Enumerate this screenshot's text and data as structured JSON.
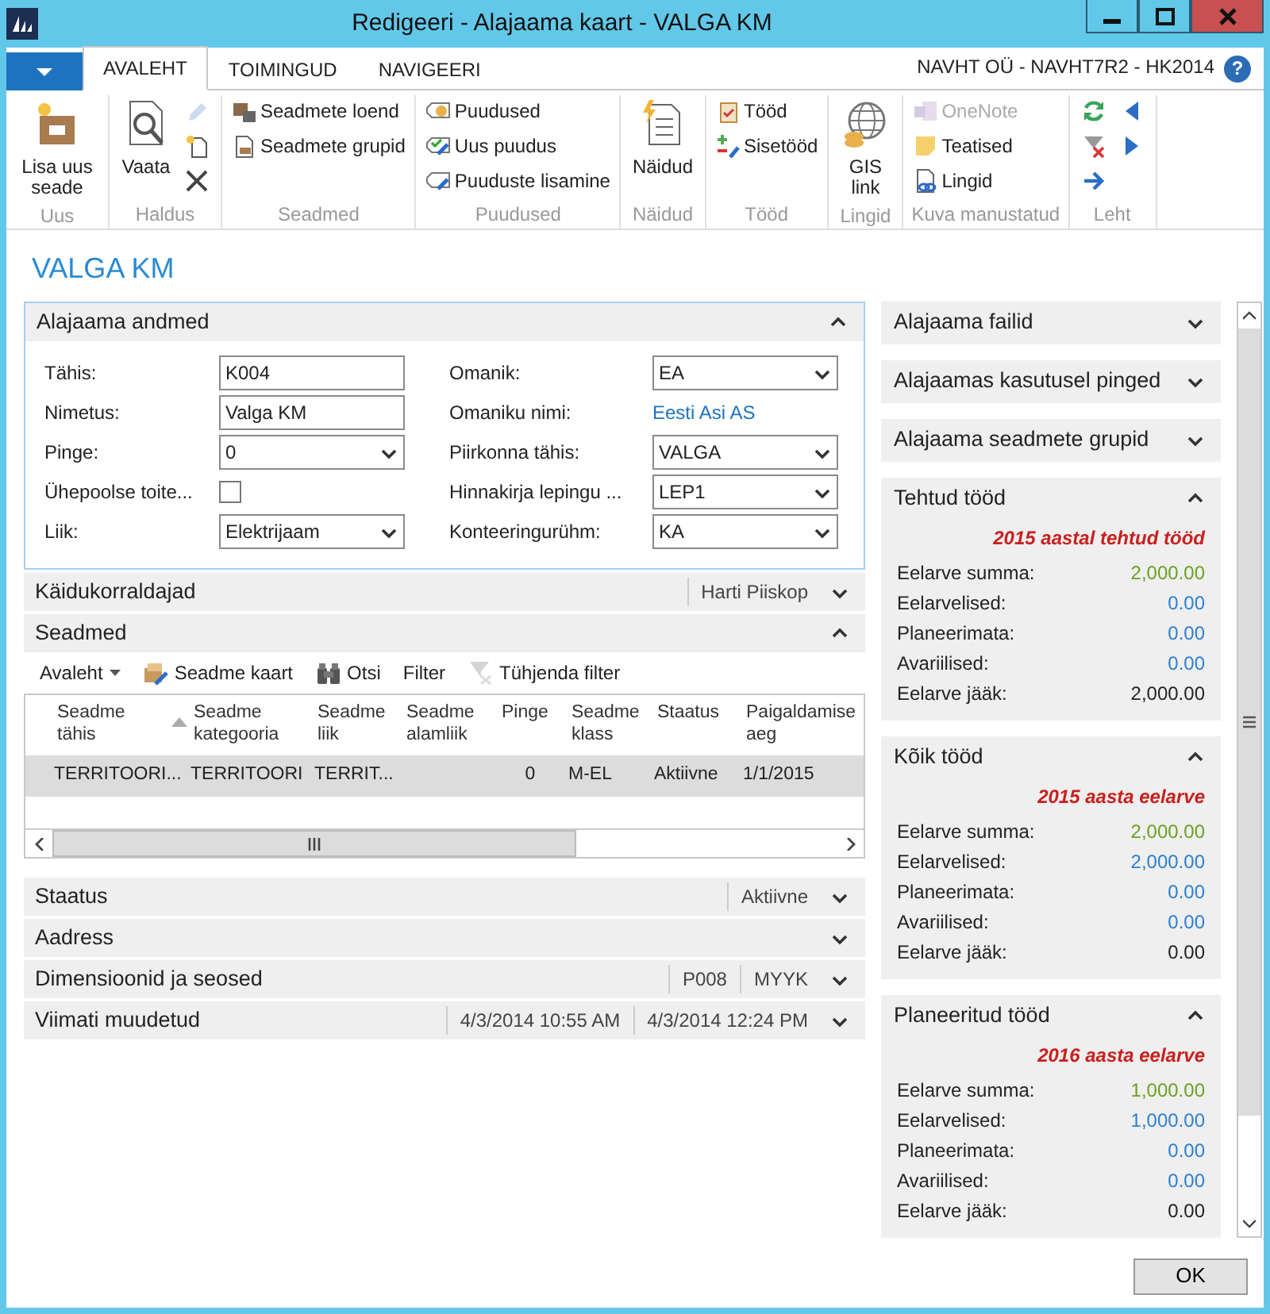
{
  "window": {
    "title": "Redigeeri - Alajaama kaart - VALGA KM"
  },
  "ribbon": {
    "tabs": [
      {
        "label": "AVALEHT",
        "selected": true
      },
      {
        "label": "TOIMINGUD",
        "selected": false
      },
      {
        "label": "NAVIGEERI",
        "selected": false
      }
    ],
    "company": "NAVHT OÜ - NAVHT7R2 - HK2014",
    "help": "?",
    "groups": [
      {
        "label": "Uus",
        "items": [
          {
            "kind": "large",
            "label": "Lisa uus seade",
            "disabled": false
          }
        ]
      },
      {
        "label": "Haldus",
        "items": [
          {
            "kind": "large",
            "label": "Vaata",
            "disabled": false
          },
          {
            "kind": "icon",
            "disabled": true
          },
          {
            "kind": "icon",
            "disabled": false
          },
          {
            "kind": "icon",
            "disabled": false
          }
        ]
      },
      {
        "label": "Seadmed",
        "items": [
          {
            "kind": "small",
            "label": "Seadmete loend",
            "disabled": false
          },
          {
            "kind": "small",
            "label": "Seadmete grupid",
            "disabled": false
          }
        ]
      },
      {
        "label": "Puudused",
        "items": [
          {
            "kind": "small",
            "label": "Puudused",
            "disabled": false
          },
          {
            "kind": "small",
            "label": "Uus puudus",
            "disabled": false
          },
          {
            "kind": "small",
            "label": "Puuduste lisamine",
            "disabled": false
          }
        ]
      },
      {
        "label": "Näidud",
        "items": [
          {
            "kind": "large",
            "label": "Näidud",
            "disabled": false
          }
        ]
      },
      {
        "label": "Tööd",
        "items": [
          {
            "kind": "small",
            "label": "Tööd",
            "disabled": false
          },
          {
            "kind": "small",
            "label": "Sisetööd",
            "disabled": false
          }
        ]
      },
      {
        "label": "Lingid",
        "items": [
          {
            "kind": "large",
            "label": "GIS link",
            "disabled": false
          }
        ]
      },
      {
        "label": "Kuva manustatud",
        "items": [
          {
            "kind": "small",
            "label": "OneNote",
            "disabled": true
          },
          {
            "kind": "small",
            "label": "Teatised",
            "disabled": false
          },
          {
            "kind": "small",
            "label": "Lingid",
            "disabled": false
          }
        ]
      },
      {
        "label": "Leht",
        "items": [
          {
            "kind": "icon",
            "disabled": false
          },
          {
            "kind": "icon",
            "disabled": false
          },
          {
            "kind": "icon",
            "disabled": false
          },
          {
            "kind": "icon",
            "disabled": false
          },
          {
            "kind": "icon",
            "disabled": false
          }
        ]
      }
    ]
  },
  "page_title": "VALGA KM",
  "general": {
    "title": "Alajaama andmed",
    "expanded": true,
    "left_fields": [
      {
        "label": "Tähis:",
        "kind": "text",
        "value": "K004"
      },
      {
        "label": "Nimetus:",
        "kind": "text",
        "value": "Valga KM"
      },
      {
        "label": "Pinge:",
        "kind": "select",
        "value": "0"
      },
      {
        "label": "Ühepoolse toite...",
        "kind": "checkbox",
        "checked": false
      },
      {
        "label": "Liik:",
        "kind": "select",
        "value": "Elektrijaam"
      }
    ],
    "right_fields": [
      {
        "label": "Omanik:",
        "kind": "select",
        "value": "EA"
      },
      {
        "label": "Omaniku nimi:",
        "kind": "link",
        "value": "Eesti Asi AS"
      },
      {
        "label": "Piirkonna tähis:",
        "kind": "select",
        "value": "VALGA"
      },
      {
        "label": "Hinnakirja lepingu ...",
        "kind": "select",
        "value": "LEP1"
      },
      {
        "label": "Konteeringurühm:",
        "kind": "select",
        "value": "KA"
      }
    ]
  },
  "fasttabs_top": [
    {
      "title": "Käidukorraldajad",
      "expanded": false,
      "summary": [
        "Harti Piiskop"
      ]
    }
  ],
  "equipment": {
    "title": "Seadmed",
    "expanded": true,
    "actions": [
      {
        "kind": "menu",
        "label": "Avaleht",
        "disabled": false
      },
      {
        "kind": "command",
        "label": "Seadme kaart",
        "disabled": false
      },
      {
        "kind": "command",
        "label": "Otsi",
        "disabled": false
      },
      {
        "kind": "command",
        "label": "Filter",
        "disabled": false
      },
      {
        "kind": "command",
        "label": "Tühjenda filter",
        "disabled": true
      }
    ],
    "columns": [
      {
        "label": "Seadme tähis",
        "sorted": true
      },
      {
        "label": "Seadme kategooria",
        "sorted": false
      },
      {
        "label": "Seadme liik",
        "sorted": false
      },
      {
        "label": "Seadme alamliik",
        "sorted": false
      },
      {
        "label": "Pinge",
        "sorted": false
      },
      {
        "label": "Seadme klass",
        "sorted": false
      },
      {
        "label": "Staatus",
        "sorted": false
      },
      {
        "label": "Paigaldamise aeg",
        "sorted": false
      }
    ],
    "rows": [
      {
        "selected": true,
        "cells": [
          "TERRITOORI...",
          "TERRITOORI",
          "TERRIT...",
          null,
          "0",
          "M-EL",
          "Aktiivne",
          "1/1/2015"
        ]
      }
    ]
  },
  "fasttabs_bottom": [
    {
      "title": "Staatus",
      "expanded": false,
      "summary": [
        "Aktiivne"
      ]
    },
    {
      "title": "Aadress",
      "expanded": false
    },
    {
      "title": "Dimensioonid ja seosed",
      "expanded": false,
      "summary": [
        "P008",
        "MYYK"
      ]
    },
    {
      "title": "Viimati muudetud",
      "expanded": false,
      "summary": [
        "4/3/2014 10:55 AM",
        "4/3/2014 12:24 PM"
      ]
    }
  ],
  "factboxes": [
    {
      "title": "Alajaama failid",
      "expanded": false
    },
    {
      "title": "Alajaamas kasutusel pinged",
      "expanded": false
    },
    {
      "title": "Alajaama seadmete grupid",
      "expanded": false
    },
    {
      "title": "Tehtud tööd",
      "expanded": true,
      "subtitle": "2015 aastal tehtud tööd",
      "rows": [
        {
          "label": "Eelarve summa:",
          "value": "2,000.00",
          "color": "#6aa121"
        },
        {
          "label": "Eelarvelised:",
          "value": "0.00",
          "color": "#2a7fd4"
        },
        {
          "label": "Planeerimata:",
          "value": "0.00",
          "color": "#2a7fd4"
        },
        {
          "label": "Avariilised:",
          "value": "0.00",
          "color": "#2a7fd4"
        },
        {
          "label": "Eelarve jääk:",
          "value": "2,000.00",
          "color": "#222222"
        }
      ]
    },
    {
      "title": "Kõik tööd",
      "expanded": true,
      "subtitle": "2015 aasta eelarve",
      "rows": [
        {
          "label": "Eelarve summa:",
          "value": "2,000.00",
          "color": "#6aa121"
        },
        {
          "label": "Eelarvelised:",
          "value": "2,000.00",
          "color": "#2a7fd4"
        },
        {
          "label": "Planeerimata:",
          "value": "0.00",
          "color": "#2a7fd4"
        },
        {
          "label": "Avariilised:",
          "value": "0.00",
          "color": "#2a7fd4"
        },
        {
          "label": "Eelarve jääk:",
          "value": "0.00",
          "color": "#222222"
        }
      ]
    },
    {
      "title": "Planeeritud tööd",
      "expanded": true,
      "subtitle": "2016 aasta eelarve",
      "rows": [
        {
          "label": "Eelarve summa:",
          "value": "1,000.00",
          "color": "#6aa121"
        },
        {
          "label": "Eelarvelised:",
          "value": "1,000.00",
          "color": "#2a7fd4"
        },
        {
          "label": "Planeerimata:",
          "value": "0.00",
          "color": "#2a7fd4"
        },
        {
          "label": "Avariilised:",
          "value": "0.00",
          "color": "#2a7fd4"
        },
        {
          "label": "Eelarve jääk:",
          "value": "0.00",
          "color": "#222222"
        }
      ]
    }
  ],
  "buttons": [
    "OK"
  ]
}
